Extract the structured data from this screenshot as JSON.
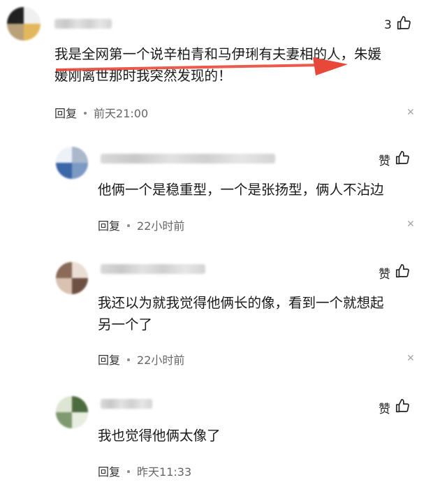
{
  "comments": [
    {
      "text": "我是全网第一个说辛柏青和马伊琍有夫妻相的人，朱媛\n媛刚离世那时我突然发现的！",
      "reply_label": "回复",
      "time": "前天21:00",
      "like_count": "3",
      "avatar_colors": [
        "#1b1b1b",
        "#e8c080",
        "#6b5a4a"
      ],
      "accent": "#e8483a"
    },
    {
      "text": "他俩一个是稳重型，一个是张扬型，俩人不沾边",
      "reply_label": "回复",
      "time": "22小时前",
      "like_label": "赞",
      "avatar_colors": [
        "#3a67a8",
        "#c9d6e8",
        "#7d9ac4"
      ]
    },
    {
      "text": "我还以为就我觉得他俩长的像，看到一个就想起\n另一个了",
      "reply_label": "回复",
      "time": "22小时前",
      "like_label": "赞",
      "avatar_colors": [
        "#6e5142",
        "#c9b2a2",
        "#eaded4"
      ]
    },
    {
      "text": "我也觉得他俩太像了",
      "reply_label": "回复",
      "time": "昨天11:33",
      "like_label": "赞",
      "avatar_colors": [
        "#4c6b3e",
        "#9cb28c",
        "#dde6d4"
      ]
    }
  ],
  "icons": {
    "like": "thumbs-up-icon",
    "close": "close-icon"
  }
}
